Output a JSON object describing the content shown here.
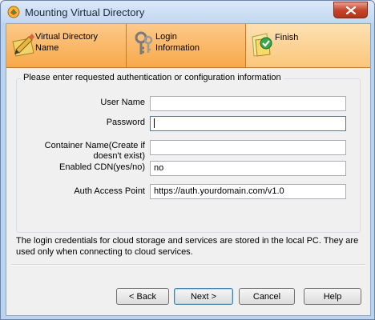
{
  "window": {
    "title": "Mounting Virtual Directory",
    "close_icon": "close-x-icon"
  },
  "steps": [
    {
      "label": "Virtual Directory\nName",
      "icon": "pencil-folder-icon"
    },
    {
      "label": "Login\nInformation",
      "icon": "keys-icon"
    },
    {
      "label": "Finish",
      "icon": "check-folder-icon"
    }
  ],
  "form": {
    "group_title": "Please enter requested authentication or configuration information",
    "fields": [
      {
        "label": "User Name",
        "value": ""
      },
      {
        "label": "Password",
        "value": ""
      },
      {
        "label": "Container Name(Create if doesn't exist)",
        "value": ""
      },
      {
        "label": "Enabled CDN(yes/no)",
        "value": "no"
      },
      {
        "label": "Auth Access Point",
        "value": "https://auth.yourdomain.com/v1.0"
      }
    ]
  },
  "info_text": "The login credentials for cloud storage and services are stored in the local PC. They are used only when connecting to cloud services.",
  "buttons": {
    "back": "< Back",
    "next": "Next >",
    "cancel": "Cancel",
    "help": "Help"
  },
  "colors": {
    "step_bg": "#f7a94a",
    "step_active_bg": "#fbc67a",
    "close_button": "#c7452b",
    "titlebar": "#c2d7f0"
  }
}
